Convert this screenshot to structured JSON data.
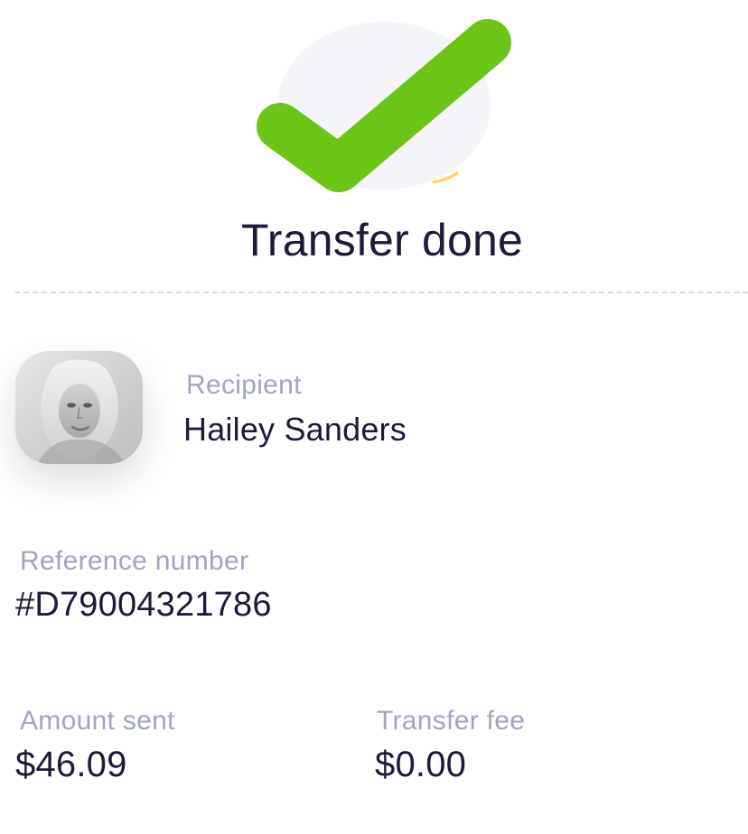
{
  "status": {
    "title": "Transfer done",
    "icon": "check-icon",
    "accent_color": "#6cc417",
    "icon_bg_color": "#f4f5f9",
    "icon_edge_color": "#ffd24a"
  },
  "recipient": {
    "label": "Recipient",
    "name": "Hailey Sanders",
    "avatar_icon": "avatar-photo"
  },
  "reference": {
    "label": "Reference number",
    "value": "#D79004321786"
  },
  "amounts": {
    "amount_sent_label": "Amount sent",
    "amount_sent_value": "$46.09",
    "transfer_fee_label": "Transfer fee",
    "transfer_fee_value": "$0.00"
  }
}
